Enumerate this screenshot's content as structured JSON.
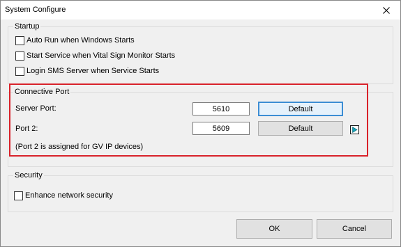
{
  "window": {
    "title": "System Configure"
  },
  "startup": {
    "label": "Startup",
    "options": [
      {
        "label": "Auto Run when Windows Starts",
        "checked": false
      },
      {
        "label": "Start Service when Vital Sign Monitor Starts",
        "checked": false
      },
      {
        "label": "Login SMS Server when Service Starts",
        "checked": false
      }
    ]
  },
  "connective_port": {
    "label": "Connective Port",
    "server_port": {
      "label": "Server Port:",
      "value": "5610",
      "button": "Default"
    },
    "port2": {
      "label": "Port 2:",
      "value": "5609",
      "button": "Default"
    },
    "note": "(Port 2 is assigned for GV IP devices)"
  },
  "security": {
    "label": "Security",
    "options": [
      {
        "label": "Enhance network security",
        "checked": false
      }
    ]
  },
  "footer": {
    "ok_label": "OK",
    "cancel_label": "Cancel"
  },
  "colors": {
    "highlight": "#d9222a",
    "arrow_fill": "#17a2b8",
    "focus_border": "#3c8dd4"
  }
}
